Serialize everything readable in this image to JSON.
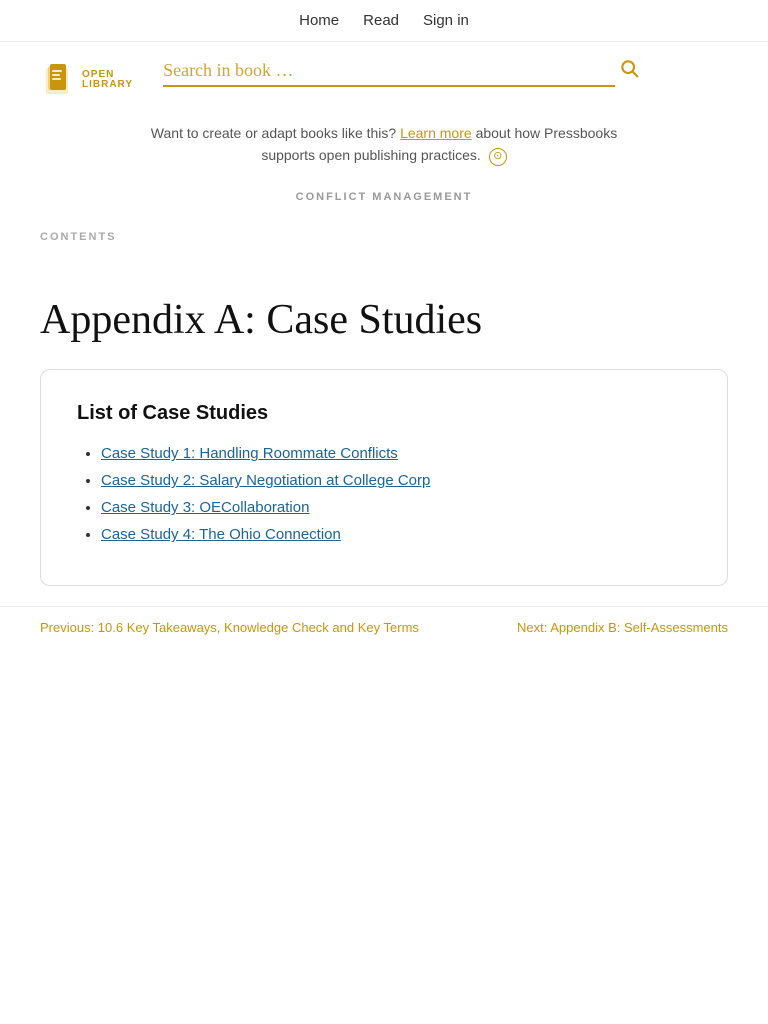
{
  "nav": {
    "items": [
      {
        "label": "Home",
        "href": "#"
      },
      {
        "label": "Read",
        "href": "#"
      },
      {
        "label": "Sign in",
        "href": "#"
      }
    ]
  },
  "logo": {
    "line1": "OPEN",
    "line2": "LIBRARY"
  },
  "search": {
    "placeholder": "Search in book …",
    "button_label": "Search"
  },
  "banner": {
    "text_before": "Want to create or adapt books like this?",
    "link_text": "Learn more",
    "text_after": "about how Pressbooks supports open publishing practices.",
    "circle_icon": "⊙"
  },
  "book": {
    "subject": "CONFLICT MANAGEMENT"
  },
  "contents_label": "CONTENTS",
  "page": {
    "title": "Appendix A: Case Studies"
  },
  "card": {
    "heading": "List of Case Studies",
    "items": [
      {
        "label": "Case Study 1: Handling Roommate Conflicts",
        "href": "#"
      },
      {
        "label": "Case Study 2: Salary Negotiation at College Corp",
        "href": "#"
      },
      {
        "label": "Case Study 3: OECollaboration",
        "href": "#"
      },
      {
        "label": "Case Study 4: The Ohio Connection",
        "href": "#"
      }
    ]
  },
  "bottom_nav": {
    "prev_label": "Previous: 10.6 Key Takeaways, Knowledge Check and Key Terms",
    "next_label": "Next: Appendix B: Self-Assessments"
  }
}
